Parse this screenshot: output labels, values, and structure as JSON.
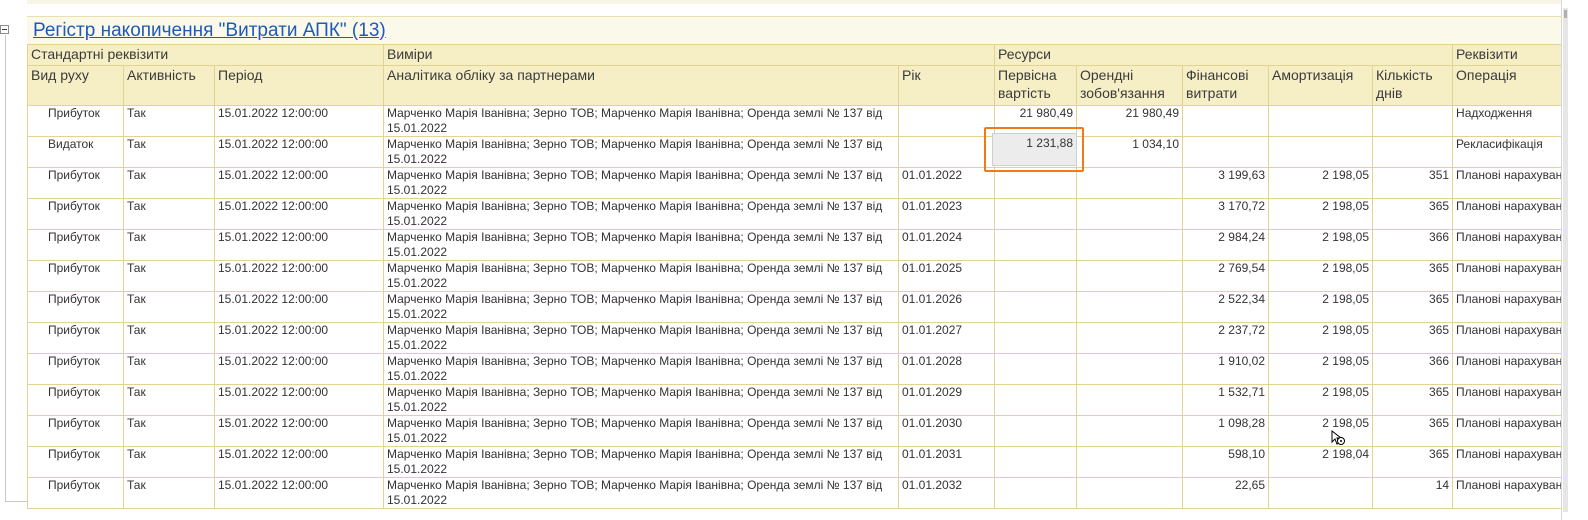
{
  "report": {
    "title": "Регістр накопичення \"Витрати АПК\" (13)"
  },
  "header": {
    "groups": {
      "standard": "Стандартні реквізити",
      "dimensions": "Виміри",
      "resources": "Ресурси",
      "attributes": "Реквізити"
    },
    "columns": {
      "movement_type": "Вид руху",
      "activity": "Активність",
      "period": "Період",
      "analytics": "Аналітика обліку за партнерами",
      "year": "Рік",
      "initial_cost": "Первісна вартість",
      "lease_liability": "Орендні зобов'язання",
      "financial_expenses": "Фінансові витрати",
      "depreciation": "Амортизація",
      "days": "Кількість днів",
      "operation": "Операція"
    }
  },
  "rows": [
    {
      "type": "Прибуток",
      "kind": "in",
      "activity": "Так",
      "period": "15.01.2022 12:00:00",
      "analytics": "Марченко Марія Іванівна; Зерно ТОВ; Марченко Марія Іванівна; Оренда землі № 137 від 15.01.2022",
      "year": "",
      "initial_cost": "21 980,49",
      "lease": "21 980,49",
      "fin": "",
      "dep": "",
      "days": "",
      "operation": "Надходження"
    },
    {
      "type": "Видаток",
      "kind": "out",
      "activity": "Так",
      "period": "15.01.2022 12:00:00",
      "analytics": "Марченко Марія Іванівна; Зерно ТОВ; Марченко Марія Іванівна; Оренда землі № 137 від 15.01.2022",
      "year": "",
      "initial_cost": "1 231,88",
      "lease": "1 034,10",
      "fin": "",
      "dep": "",
      "days": "",
      "operation": "Рекласифікація"
    },
    {
      "type": "Прибуток",
      "kind": "in",
      "activity": "Так",
      "period": "15.01.2022 12:00:00",
      "analytics": "Марченко Марія Іванівна; Зерно ТОВ; Марченко Марія Іванівна; Оренда землі № 137 від 15.01.2022",
      "year": "01.01.2022",
      "initial_cost": "",
      "lease": "",
      "fin": "3 199,63",
      "dep": "2 198,05",
      "days": "351",
      "operation": "Планові нарахування"
    },
    {
      "type": "Прибуток",
      "kind": "in",
      "activity": "Так",
      "period": "15.01.2022 12:00:00",
      "analytics": "Марченко Марія Іванівна; Зерно ТОВ; Марченко Марія Іванівна; Оренда землі № 137 від 15.01.2022",
      "year": "01.01.2023",
      "initial_cost": "",
      "lease": "",
      "fin": "3 170,72",
      "dep": "2 198,05",
      "days": "365",
      "operation": "Планові нарахування"
    },
    {
      "type": "Прибуток",
      "kind": "in",
      "activity": "Так",
      "period": "15.01.2022 12:00:00",
      "analytics": "Марченко Марія Іванівна; Зерно ТОВ; Марченко Марія Іванівна; Оренда землі № 137 від 15.01.2022",
      "year": "01.01.2024",
      "initial_cost": "",
      "lease": "",
      "fin": "2 984,24",
      "dep": "2 198,05",
      "days": "366",
      "operation": "Планові нарахування"
    },
    {
      "type": "Прибуток",
      "kind": "in",
      "activity": "Так",
      "period": "15.01.2022 12:00:00",
      "analytics": "Марченко Марія Іванівна; Зерно ТОВ; Марченко Марія Іванівна; Оренда землі № 137 від 15.01.2022",
      "year": "01.01.2025",
      "initial_cost": "",
      "lease": "",
      "fin": "2 769,54",
      "dep": "2 198,05",
      "days": "365",
      "operation": "Планові нарахування"
    },
    {
      "type": "Прибуток",
      "kind": "in",
      "activity": "Так",
      "period": "15.01.2022 12:00:00",
      "analytics": "Марченко Марія Іванівна; Зерно ТОВ; Марченко Марія Іванівна; Оренда землі № 137 від 15.01.2022",
      "year": "01.01.2026",
      "initial_cost": "",
      "lease": "",
      "fin": "2 522,34",
      "dep": "2 198,05",
      "days": "365",
      "operation": "Планові нарахування"
    },
    {
      "type": "Прибуток",
      "kind": "in",
      "activity": "Так",
      "period": "15.01.2022 12:00:00",
      "analytics": "Марченко Марія Іванівна; Зерно ТОВ; Марченко Марія Іванівна; Оренда землі № 137 від 15.01.2022",
      "year": "01.01.2027",
      "initial_cost": "",
      "lease": "",
      "fin": "2 237,72",
      "dep": "2 198,05",
      "days": "365",
      "operation": "Планові нарахування"
    },
    {
      "type": "Прибуток",
      "kind": "in",
      "activity": "Так",
      "period": "15.01.2022 12:00:00",
      "analytics": "Марченко Марія Іванівна; Зерно ТОВ; Марченко Марія Іванівна; Оренда землі № 137 від 15.01.2022",
      "year": "01.01.2028",
      "initial_cost": "",
      "lease": "",
      "fin": "1 910,02",
      "dep": "2 198,05",
      "days": "366",
      "operation": "Планові нарахування"
    },
    {
      "type": "Прибуток",
      "kind": "in",
      "activity": "Так",
      "period": "15.01.2022 12:00:00",
      "analytics": "Марченко Марія Іванівна; Зерно ТОВ; Марченко Марія Іванівна; Оренда землі № 137 від 15.01.2022",
      "year": "01.01.2029",
      "initial_cost": "",
      "lease": "",
      "fin": "1 532,71",
      "dep": "2 198,05",
      "days": "365",
      "operation": "Планові нарахування"
    },
    {
      "type": "Прибуток",
      "kind": "in",
      "activity": "Так",
      "period": "15.01.2022 12:00:00",
      "analytics": "Марченко Марія Іванівна; Зерно ТОВ; Марченко Марія Іванівна; Оренда землі № 137 від 15.01.2022",
      "year": "01.01.2030",
      "initial_cost": "",
      "lease": "",
      "fin": "1 098,28",
      "dep": "2 198,05",
      "days": "365",
      "operation": "Планові нарахування"
    },
    {
      "type": "Прибуток",
      "kind": "in",
      "activity": "Так",
      "period": "15.01.2022 12:00:00",
      "analytics": "Марченко Марія Іванівна; Зерно ТОВ; Марченко Марія Іванівна; Оренда землі № 137 від 15.01.2022",
      "year": "01.01.2031",
      "initial_cost": "",
      "lease": "",
      "fin": "598,10",
      "dep": "2 198,04",
      "days": "365",
      "operation": "Планові нарахування"
    },
    {
      "type": "Прибуток",
      "kind": "in",
      "activity": "Так",
      "period": "15.01.2022 12:00:00",
      "analytics": "Марченко Марія Іванівна; Зерно ТОВ; Марченко Марія Іванівна; Оренда землі № 137 від 15.01.2022",
      "year": "01.01.2032",
      "initial_cost": "",
      "lease": "",
      "fin": "22,65",
      "dep": "",
      "days": "14",
      "operation": "Планові нарахування"
    }
  ],
  "colors": {
    "header_bg": "#f6efc6",
    "grid": "#e2d392",
    "title_link": "#1e5bb5",
    "income": "#1a8a1a",
    "expense": "#e01a1a",
    "selection": "#f07a1a"
  },
  "icons": {
    "collapse": "minus-box-icon",
    "cursor": "busy-cursor-icon"
  }
}
